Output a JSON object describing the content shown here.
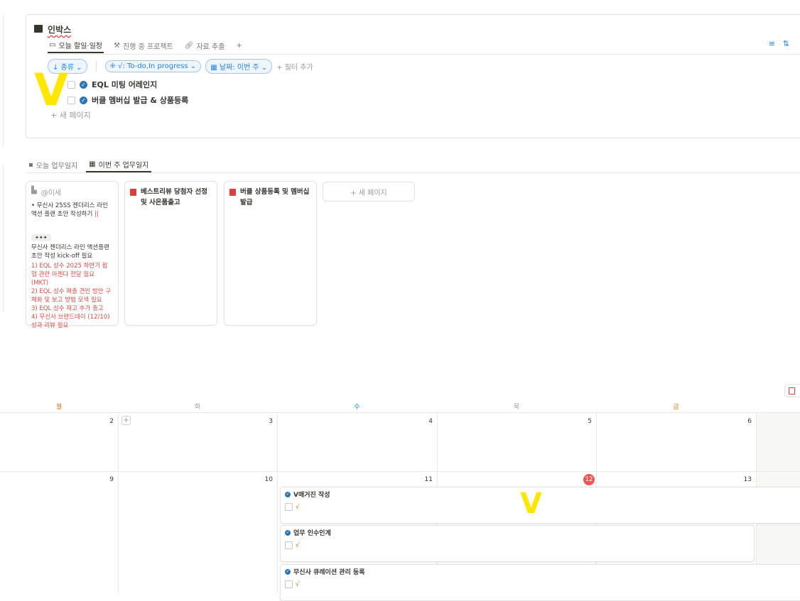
{
  "inbox": {
    "title": "인박스",
    "tabs": [
      "오늘 할일·일정",
      "진행 중 프로젝트",
      "자료 추출"
    ],
    "add_tab": "+",
    "filters": {
      "sort": "↓ 종류",
      "status": "√: To-do,In progress",
      "date": "날짜: 이번 주",
      "add": "필터 추가"
    },
    "items": [
      "EQL 미팅 어레인지",
      "버클 멤버십 발급 & 상품등록"
    ],
    "new_page": "새 페이지"
  },
  "worklog": {
    "tabs": [
      "오늘 업무일지",
      "이번 주 업무일지"
    ],
    "cards": [
      {
        "author": "@이세",
        "bullet": "• 무신사 25SS 젠더리스 라인 액션 플랜 초안 작성하기",
        "badge": "✦✦✦",
        "body": "무신사 젠더리스 라인 액션플랜 초안 작성 kick-off 필요",
        "notes": [
          "1) EQL 성수 2025 하반기 팝업 관련 아젠다 전달 필요 (MKT)",
          "2) EQL 성수 매출 견인 방안 구체화 및 보고 방법 모색 필요",
          "3) EQL 성수 재고 추가 출고",
          "4) 무신사 브랜드데이 (12/10) 성과 리뷰 필요"
        ]
      },
      {
        "title": "베스트리뷰 당첨자 선정 및 사은품출고"
      },
      {
        "title": "버클 상품등록 및 멤버십 발급"
      }
    ],
    "new_page": "+ 새 페이지"
  },
  "calendar": {
    "weekdays": [
      "월",
      "화",
      "수",
      "목",
      "금"
    ],
    "week1": [
      "2",
      "3",
      "4",
      "5",
      "6"
    ],
    "week2": [
      "9",
      "10",
      "11",
      "12",
      "13"
    ],
    "today": "12",
    "events": [
      {
        "title": "V매거진 작성",
        "sub": "√"
      },
      {
        "title": "업무 인수인계",
        "sub": "√"
      },
      {
        "title": "무신사 큐레이션 관리 등록",
        "sub": "√"
      }
    ]
  }
}
